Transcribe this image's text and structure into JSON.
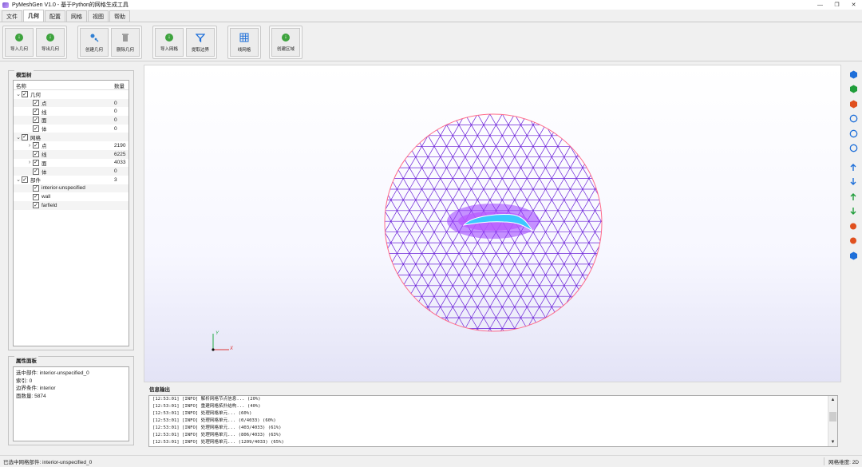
{
  "window": {
    "title": "PyMeshGen V1.0 - 基于Python的网格生成工具",
    "minimize": "—",
    "maximize": "❐",
    "close": "✕"
  },
  "menu": {
    "tabs": [
      "文件",
      "几何",
      "配置",
      "网格",
      "视图",
      "帮助"
    ],
    "active": "几何"
  },
  "ribbon": {
    "import_geo": "导入几何",
    "export_geo": "导出几何",
    "create_geo": "创建几何",
    "delete_geo": "删除几何",
    "import_mesh": "导入网格",
    "extract_boundary": "提取边界",
    "line_mesh": "线网格",
    "create_region": "创建区域"
  },
  "model_tree": {
    "title": "模型树",
    "col_name": "名称",
    "col_count": "数量",
    "rows": [
      {
        "label": "几何",
        "count": "",
        "level": 0,
        "arrow": "⌄",
        "checked": true
      },
      {
        "label": "点",
        "count": "0",
        "level": 1,
        "arrow": "",
        "checked": true
      },
      {
        "label": "线",
        "count": "0",
        "level": 1,
        "arrow": "",
        "checked": true
      },
      {
        "label": "面",
        "count": "0",
        "level": 1,
        "arrow": "",
        "checked": true
      },
      {
        "label": "体",
        "count": "0",
        "level": 1,
        "arrow": "",
        "checked": true
      },
      {
        "label": "网格",
        "count": "",
        "level": 0,
        "arrow": "⌄",
        "checked": true
      },
      {
        "label": "点",
        "count": "2190",
        "level": 1,
        "arrow": "›",
        "checked": true
      },
      {
        "label": "线",
        "count": "6225",
        "level": 1,
        "arrow": "",
        "checked": true
      },
      {
        "label": "面",
        "count": "4033",
        "level": 1,
        "arrow": "›",
        "checked": true
      },
      {
        "label": "体",
        "count": "0",
        "level": 1,
        "arrow": "",
        "checked": true
      },
      {
        "label": "部件",
        "count": "3",
        "level": 0,
        "arrow": "⌄",
        "checked": true
      },
      {
        "label": "interior-unspecified",
        "count": "",
        "level": 1,
        "arrow": "",
        "checked": true
      },
      {
        "label": "wall",
        "count": "",
        "level": 1,
        "arrow": "",
        "checked": true
      },
      {
        "label": "farfield",
        "count": "",
        "level": 1,
        "arrow": "",
        "checked": true
      }
    ]
  },
  "properties": {
    "title": "属性面板",
    "lines": [
      "选中部件: interior-unspecified_0",
      "索引: 0",
      "边界条件: interior",
      "面数量: 5874"
    ]
  },
  "viewport": {
    "axis_y": "Y",
    "axis_x": "X",
    "mesh_color": "#6a1fd8",
    "boundary_color": "#ff6b8a",
    "wall_color": "#3cc8ff"
  },
  "output": {
    "title": "信息输出",
    "lines": [
      "[12:53:01] [INFO] 解析网格节点信息... (20%)",
      "[12:53:01] [INFO] 重建网格拓扑结构... (40%)",
      "[12:53:01] [INFO] 处理网格单元... (60%)",
      "[12:53:01] [INFO] 处理网格单元... (0/4033) (60%)",
      "[12:53:01] [INFO] 处理网格单元... (403/4033) (61%)",
      "[12:53:01] [INFO] 处理网格单元... (806/4033) (63%)",
      "[12:53:01] [INFO] 处理网格单元... (1209/4033) (65%)"
    ]
  },
  "status": {
    "left": "已选中网格部件: interior-unspecified_0",
    "right": "网格维度: 2D"
  },
  "right_toolbar": [
    {
      "name": "view-iso-icon",
      "color": "#1e6fd9"
    },
    {
      "name": "view-front-icon",
      "color": "#1f9d3a"
    },
    {
      "name": "view-side-icon",
      "color": "#e0501e"
    },
    {
      "name": "zoom-fit-icon",
      "color": "#1e6fd9"
    },
    {
      "name": "rotate-view-icon",
      "color": "#1e6fd9"
    },
    {
      "name": "surface-view-icon",
      "color": "#1e6fd9"
    },
    {
      "name": "axis-x-plus-icon",
      "color": "#1e6fd9"
    },
    {
      "name": "axis-x-minus-icon",
      "color": "#1e6fd9"
    },
    {
      "name": "axis-y-plus-icon",
      "color": "#1f9d3a"
    },
    {
      "name": "axis-y-minus-icon",
      "color": "#1f9d3a"
    },
    {
      "name": "axis-z-plus-icon",
      "color": "#e0501e"
    },
    {
      "name": "axis-z-minus-icon",
      "color": "#e0501e"
    },
    {
      "name": "perspective-icon",
      "color": "#1e6fd9"
    }
  ]
}
